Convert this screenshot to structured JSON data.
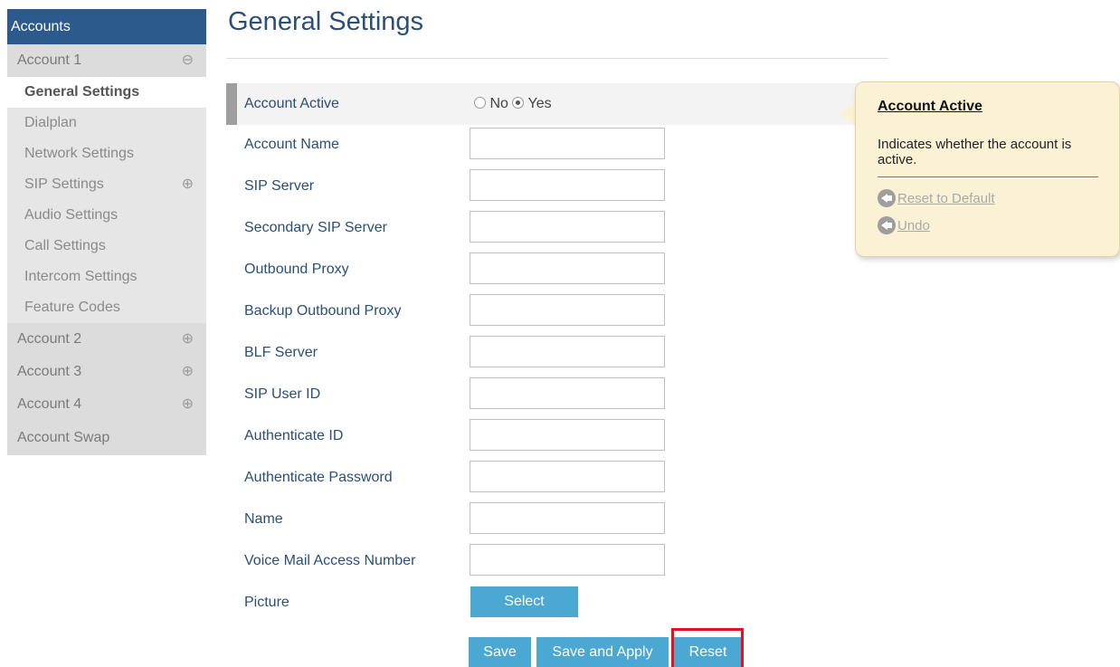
{
  "sidebar": {
    "header": "Accounts",
    "account1": {
      "label": "Account 1",
      "symbol": "⊖"
    },
    "items": [
      {
        "label": "General Settings",
        "symbol": ""
      },
      {
        "label": "Dialplan",
        "symbol": ""
      },
      {
        "label": "Network Settings",
        "symbol": ""
      },
      {
        "label": "SIP Settings",
        "symbol": "⊕"
      },
      {
        "label": "Audio Settings",
        "symbol": ""
      },
      {
        "label": "Call Settings",
        "symbol": ""
      },
      {
        "label": "Intercom Settings",
        "symbol": ""
      },
      {
        "label": "Feature Codes",
        "symbol": ""
      }
    ],
    "accounts": [
      {
        "label": "Account 2",
        "symbol": "⊕"
      },
      {
        "label": "Account 3",
        "symbol": "⊕"
      },
      {
        "label": "Account 4",
        "symbol": "⊕"
      }
    ],
    "swap": "Account Swap"
  },
  "page": {
    "title": "General Settings"
  },
  "form": {
    "account_active": {
      "label": "Account Active",
      "no": "No",
      "yes": "Yes",
      "selected": "Yes"
    },
    "fields": [
      {
        "label": "Account Name",
        "value": ""
      },
      {
        "label": "SIP Server",
        "value": ""
      },
      {
        "label": "Secondary SIP Server",
        "value": ""
      },
      {
        "label": "Outbound Proxy",
        "value": ""
      },
      {
        "label": "Backup Outbound Proxy",
        "value": ""
      },
      {
        "label": "BLF Server",
        "value": ""
      },
      {
        "label": "SIP User ID",
        "value": ""
      },
      {
        "label": "Authenticate ID",
        "value": ""
      },
      {
        "label": "Authenticate Password",
        "value": ""
      },
      {
        "label": "Name",
        "value": ""
      },
      {
        "label": "Voice Mail Access Number",
        "value": ""
      }
    ],
    "picture": {
      "label": "Picture",
      "button": "Select"
    }
  },
  "actions": {
    "save": "Save",
    "save_apply": "Save and Apply",
    "reset": "Reset"
  },
  "tooltip": {
    "title": "Account Active",
    "description": "Indicates whether the account is active.",
    "reset_default": "Reset to Default",
    "undo": "Undo"
  },
  "colors": {
    "sidebar_header": "#2c5a8c",
    "button": "#4aa8d2",
    "label_text": "#2a4f78",
    "highlight_box": "#e0141e",
    "tooltip_bg": "#fbf2d6"
  }
}
